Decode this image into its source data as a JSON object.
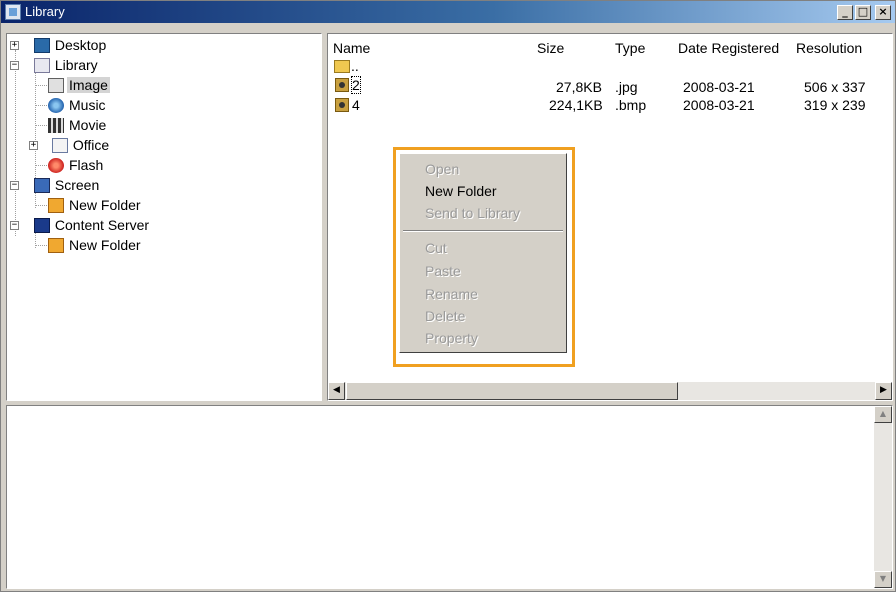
{
  "window": {
    "title": "Library"
  },
  "titlebar": {
    "minimize": "_",
    "maximize": "□",
    "close": "×"
  },
  "tree": {
    "items": [
      {
        "label": "Desktop",
        "icon": "desktop-icon",
        "expander": "+"
      },
      {
        "label": "Library",
        "icon": "library-icon",
        "expander": "−"
      },
      {
        "label": "Image",
        "icon": "image-folder-icon",
        "selected": true
      },
      {
        "label": "Music",
        "icon": "music-icon"
      },
      {
        "label": "Movie",
        "icon": "movie-icon"
      },
      {
        "label": "Office",
        "icon": "office-icon",
        "expander": "+"
      },
      {
        "label": "Flash",
        "icon": "flash-icon"
      },
      {
        "label": "Screen",
        "icon": "screen-icon",
        "expander": "−"
      },
      {
        "label": "New Folder",
        "icon": "folder-icon"
      },
      {
        "label": "Content Server",
        "icon": "content-server-icon",
        "expander": "−"
      },
      {
        "label": "New Folder",
        "icon": "folder-icon"
      }
    ]
  },
  "list": {
    "columns": [
      "Name",
      "Size",
      "Type",
      "Date Registered",
      "Resolution"
    ],
    "up_label": "..",
    "rows": [
      {
        "name": "2",
        "size": "27,8KB",
        "type": ".jpg",
        "date": "2008-03-21",
        "resolution": "506 x 337"
      },
      {
        "name": "4",
        "size": "224,1KB",
        "type": ".bmp",
        "date": "2008-03-21",
        "resolution": "319 x 239"
      }
    ]
  },
  "context_menu": {
    "items": [
      {
        "label": "Open",
        "enabled": false
      },
      {
        "label": "New Folder",
        "enabled": true
      },
      {
        "label": "Send to Library",
        "enabled": false
      },
      {
        "label": "Cut",
        "enabled": false
      },
      {
        "label": "Paste",
        "enabled": false
      },
      {
        "label": "Rename",
        "enabled": false
      },
      {
        "label": "Delete",
        "enabled": false
      },
      {
        "label": "Property",
        "enabled": false
      }
    ]
  },
  "colors": {
    "title_start": "#0a246a",
    "title_end": "#a6caf0",
    "highlight": "#f0a020",
    "face": "#d4d0c8"
  }
}
